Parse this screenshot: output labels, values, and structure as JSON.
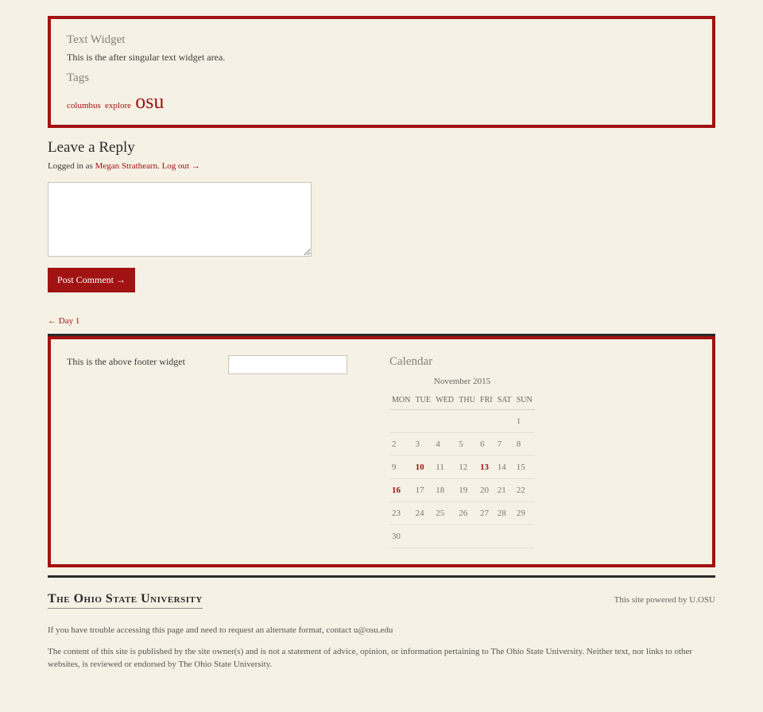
{
  "text_widget": {
    "title": "Text Widget",
    "body": "This is the after singular text widget area."
  },
  "tags": {
    "title": "Tags",
    "items": [
      {
        "label": "columbus",
        "size": "small"
      },
      {
        "label": "explore",
        "size": "small"
      },
      {
        "label": "osu",
        "size": "large"
      }
    ]
  },
  "reply": {
    "heading": "Leave a Reply",
    "logged_prefix": "Logged in as ",
    "user": "Megan Strathearn",
    "sep": ". ",
    "logout": "Log out →",
    "button": "Post Comment →"
  },
  "nav": {
    "prev_arrow": "← ",
    "prev_label": "Day 1"
  },
  "footer_widget": {
    "label": "This is the above footer widget"
  },
  "calendar": {
    "title": "Calendar",
    "caption": "November 2015",
    "dow": [
      "MON",
      "TUE",
      "WED",
      "THU",
      "FRI",
      "SAT",
      "SUN"
    ],
    "weeks": [
      [
        "",
        "",
        "",
        "",
        "",
        "",
        "1"
      ],
      [
        "2",
        "3",
        "4",
        "5",
        "6",
        "7",
        "8"
      ],
      [
        "9",
        "10",
        "11",
        "12",
        "13",
        "14",
        "15"
      ],
      [
        "16",
        "17",
        "18",
        "19",
        "20",
        "21",
        "22"
      ],
      [
        "23",
        "24",
        "25",
        "26",
        "27",
        "28",
        "29"
      ],
      [
        "30",
        "",
        "",
        "",
        "",
        "",
        ""
      ]
    ],
    "linked": [
      "10",
      "13",
      "16"
    ]
  },
  "footer": {
    "university": "The Ohio State University",
    "powered_prefix": "This site powered by ",
    "powered_link": "U.OSU",
    "access_prefix": "If you have trouble accessing this page and need to request an alternate format, contact ",
    "access_email": "u@osu.edu",
    "disclaimer": "The content of this site is published by the site owner(s) and is not a statement of advice, opinion, or information pertaining to The Ohio State University. Neither text, nor links to other websites, is reviewed or endorsed by The Ohio State University."
  }
}
